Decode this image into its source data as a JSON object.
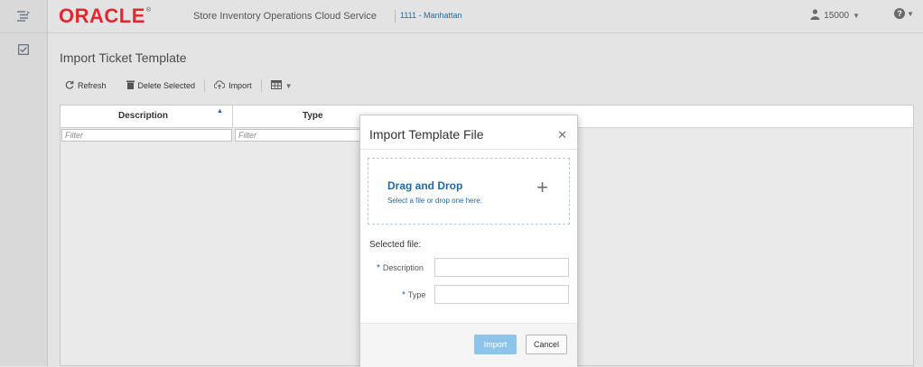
{
  "header": {
    "logo_text": "ORACLE",
    "logo_mark": "®",
    "app_title": "Store Inventory Operations Cloud Service",
    "store": "1111 - Manhattan",
    "user_id": "15000",
    "user_icon": "user-icon",
    "help_icon": "help-icon"
  },
  "nav_rail": {
    "icons": [
      "menu-tree-icon",
      "task-checkbox-icon"
    ]
  },
  "page": {
    "title": "Import Ticket Template"
  },
  "toolbar": {
    "refresh_label": "Refresh",
    "delete_label": "Delete Selected",
    "import_label": "Import"
  },
  "table": {
    "columns": [
      {
        "label": "Description",
        "sorted": "ascending"
      },
      {
        "label": "Type"
      }
    ],
    "filter_placeholder": "Filter"
  },
  "dialog": {
    "title": "Import Template File",
    "close_icon": "close-icon",
    "drop_title": "Drag and Drop",
    "drop_subtitle": "Select a file or drop one here.",
    "plus_icon": "plus-icon",
    "selected_file_label": "Selected file:",
    "description_label": "Description",
    "type_label": "Type",
    "required_mark": "*",
    "import_label": "Import",
    "cancel_label": "Cancel"
  },
  "colors": {
    "oracle_red": "#e2272e",
    "link_blue": "#2068a7",
    "import_disabled": "#8ec3ea"
  }
}
